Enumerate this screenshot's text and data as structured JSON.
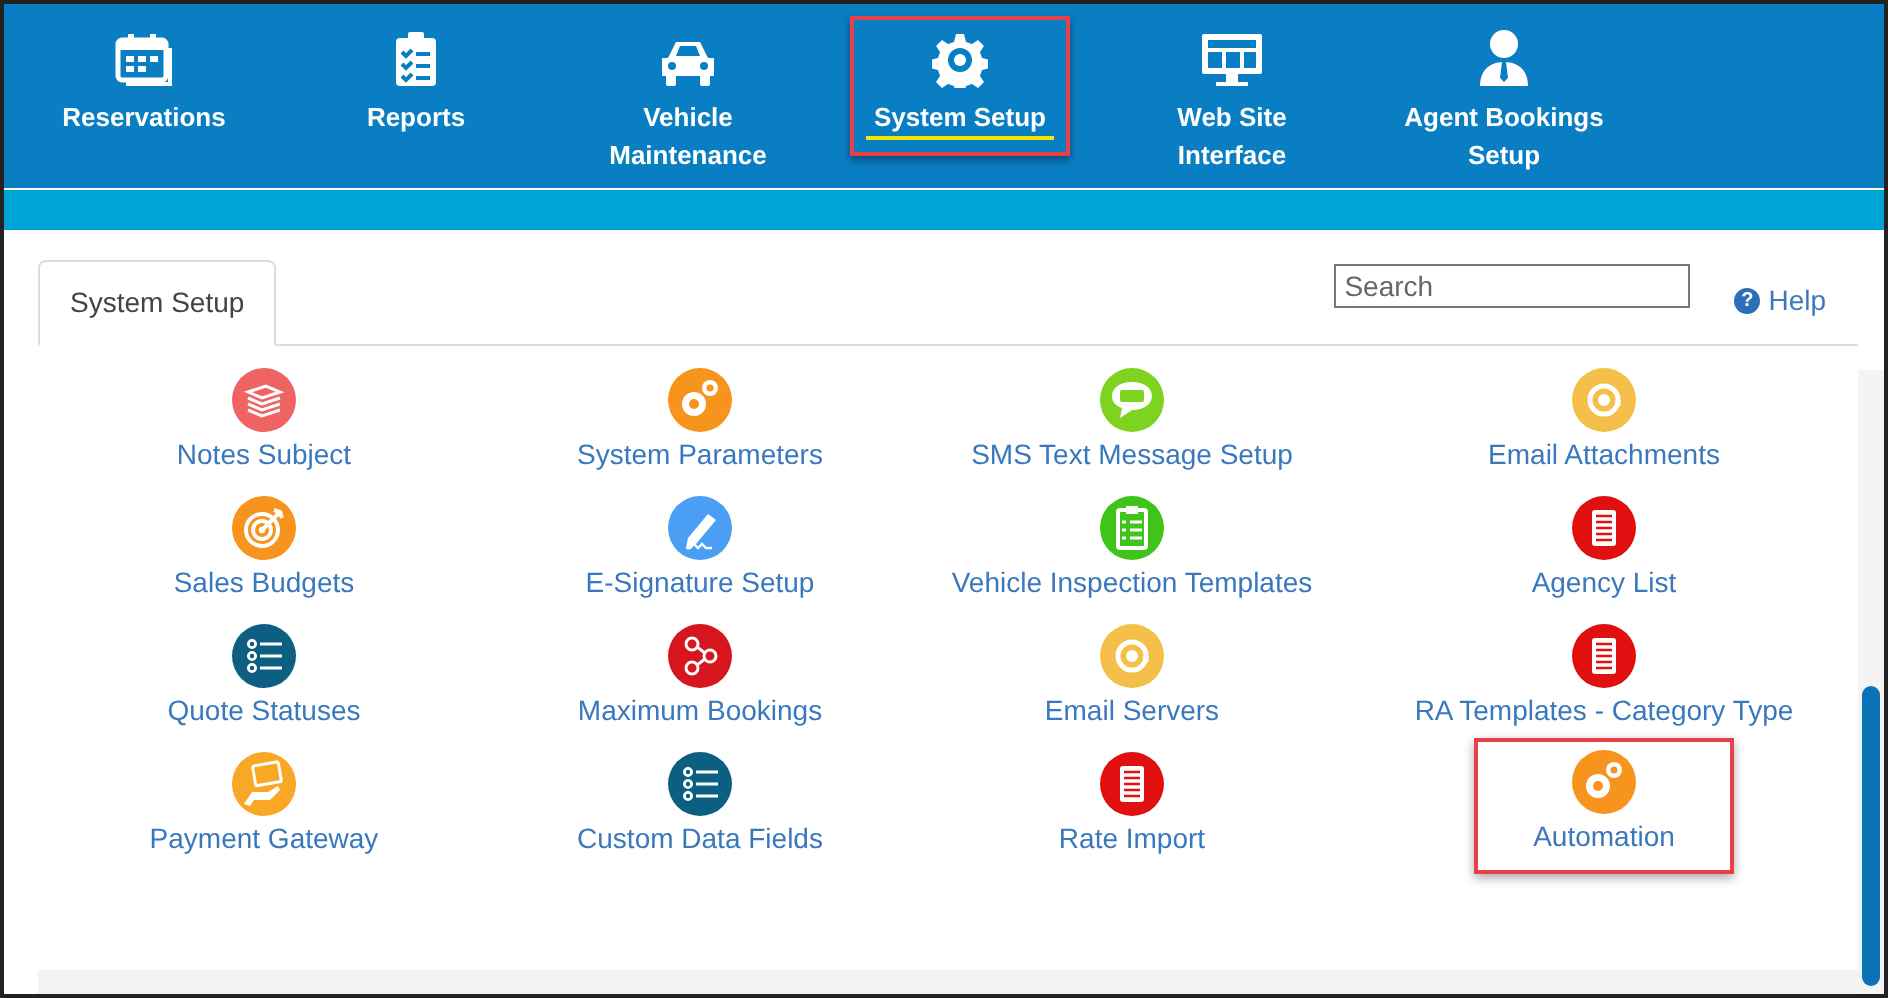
{
  "nav": [
    {
      "label": "Reservations",
      "kind": "calendar",
      "selected": false,
      "highlighted": false
    },
    {
      "label": "Reports",
      "kind": "checklist",
      "selected": false,
      "highlighted": false
    },
    {
      "label": "Vehicle Maintenance",
      "kind": "car",
      "selected": false,
      "highlighted": false
    },
    {
      "label": "System Setup",
      "kind": "gear",
      "selected": true,
      "highlighted": true
    },
    {
      "label": "Web Site Interface",
      "kind": "monitor",
      "selected": false,
      "highlighted": false
    },
    {
      "label": "Agent Bookings Setup",
      "kind": "person",
      "selected": false,
      "highlighted": false
    }
  ],
  "tabs": [
    {
      "label": "System Setup",
      "selected": true
    }
  ],
  "search": {
    "placeholder": "Search"
  },
  "help": {
    "icon": "?",
    "label": "Help"
  },
  "items": [
    {
      "label": "Notes Subject",
      "kind": "stack",
      "color": "#ef6363",
      "highlighted": false
    },
    {
      "label": "System Parameters",
      "kind": "gears",
      "color": "#f7941d",
      "highlighted": false
    },
    {
      "label": "SMS Text Message Setup",
      "kind": "sms",
      "color": "#7ed321",
      "highlighted": false
    },
    {
      "label": "Email Attachments",
      "kind": "at",
      "color": "#f5c04a",
      "highlighted": false
    },
    {
      "label": "Sales Budgets",
      "kind": "target",
      "color": "#f7941d",
      "highlighted": false
    },
    {
      "label": "E-Signature Setup",
      "kind": "pen",
      "color": "#4a9ff5",
      "highlighted": false
    },
    {
      "label": "Vehicle Inspection Templates",
      "kind": "clipboard",
      "color": "#3ec41a",
      "highlighted": false
    },
    {
      "label": "Agency List",
      "kind": "doc",
      "color": "#e01010",
      "highlighted": false
    },
    {
      "label": "Quote Statuses",
      "kind": "list",
      "color": "#0d5f82",
      "highlighted": false
    },
    {
      "label": "Maximum Bookings",
      "kind": "share",
      "color": "#d8161f",
      "highlighted": false
    },
    {
      "label": "Email Servers",
      "kind": "at",
      "color": "#f5c04a",
      "highlighted": false
    },
    {
      "label": "RA Templates - Category Type",
      "kind": "doc",
      "color": "#e01010",
      "highlighted": false
    },
    {
      "label": "Payment Gateway",
      "kind": "hand",
      "color": "#f9a825",
      "highlighted": false
    },
    {
      "label": "Custom Data Fields",
      "kind": "list",
      "color": "#0d5f82",
      "highlighted": false
    },
    {
      "label": "Rate Import",
      "kind": "doc",
      "color": "#e01010",
      "highlighted": false
    },
    {
      "label": "Automation",
      "kind": "gears",
      "color": "#f7941d",
      "highlighted": true
    }
  ]
}
